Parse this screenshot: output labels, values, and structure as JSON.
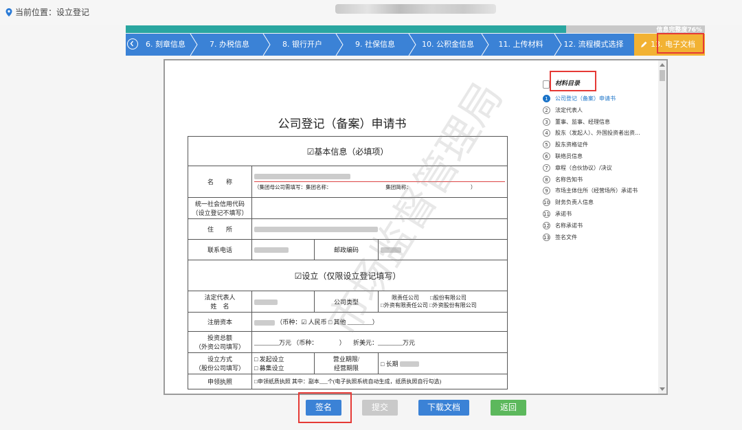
{
  "location": {
    "label": "当前位置：设立登记"
  },
  "progress": {
    "text": "信息完整度76%",
    "percent": 76
  },
  "steps": [
    {
      "label": "6. 刻章信息"
    },
    {
      "label": "7. 办税信息"
    },
    {
      "label": "8. 银行开户"
    },
    {
      "label": "9. 社保信息"
    },
    {
      "label": "10. 公积金信息"
    },
    {
      "label": "11. 上传材料"
    },
    {
      "label": "12. 流程模式选择"
    },
    {
      "label": "13. 电子文档"
    }
  ],
  "document": {
    "title": "公司登记（备案）申请书",
    "watermark": "市场监督管理局",
    "basic_section": "☑基本信息（必填项）",
    "name_label": "名　　称",
    "group_hint": "（集团母公司需填写：集团名称：　　　　　　　　　　　集团简称：　　　　　　　　　　　　）",
    "credit_code_label": "统一社会信用代码\n（设立登记不填写）",
    "address_label": "住　　所",
    "phone_label": "联系电话",
    "postcode_label": "邮政编码",
    "setup_section": "☑设立（仅限设立登记填写）",
    "legal_rep_label": "法定代表人\n姓　名",
    "company_type_label": "公司类型",
    "company_type_options": "　　限责任公司　　□股份有限公司\n□外资有限责任公司 □外资股份有限公司",
    "capital_label": "注册资本",
    "capital_value": "（币种：☑ 人民币 □ 其他 ________）",
    "investment_label": "投资总额\n（外资公司填写）",
    "investment_value": "________万元 （币种：　　　　） 　折美元：________万元",
    "method_label": "设立方式\n（股份公司填写）",
    "method_value": "□ 发起设立\n□ 募集设立",
    "term_label": "营业期限/\n经营期限",
    "term_value": "□ 长期",
    "license_label": "申领执照",
    "license_value": "□申领纸质执照 其中：副本___个(电子执照系统自动生成，纸质执照自行勾选)"
  },
  "toc": {
    "title": "材料目录",
    "items": [
      {
        "num": "1",
        "label": "公司登记（备案）申请书"
      },
      {
        "num": "2",
        "label": "法定代表人"
      },
      {
        "num": "3",
        "label": "董事、监事、经理信息"
      },
      {
        "num": "4",
        "label": "股东（发起人）、外国投资者出资..."
      },
      {
        "num": "5",
        "label": "股东资格证件"
      },
      {
        "num": "6",
        "label": "联络员信息"
      },
      {
        "num": "7",
        "label": "章程（合伙协议）/决议"
      },
      {
        "num": "8",
        "label": "名称告知书"
      },
      {
        "num": "9",
        "label": "市场主体住所（经营场所）承诺书"
      },
      {
        "num": "10",
        "label": "财务负责人信息"
      },
      {
        "num": "11",
        "label": "承诺书"
      },
      {
        "num": "12",
        "label": "名称承诺书"
      },
      {
        "num": "13",
        "label": "签名文件"
      }
    ]
  },
  "buttons": {
    "sign": "签名",
    "submit": "提交",
    "download": "下载文档",
    "back": "返回"
  },
  "colors": {
    "teal": "#2aa6a0",
    "blue": "#3b82d6",
    "orange": "#f2b233",
    "green": "#5cb85c",
    "red": "#e53935"
  }
}
